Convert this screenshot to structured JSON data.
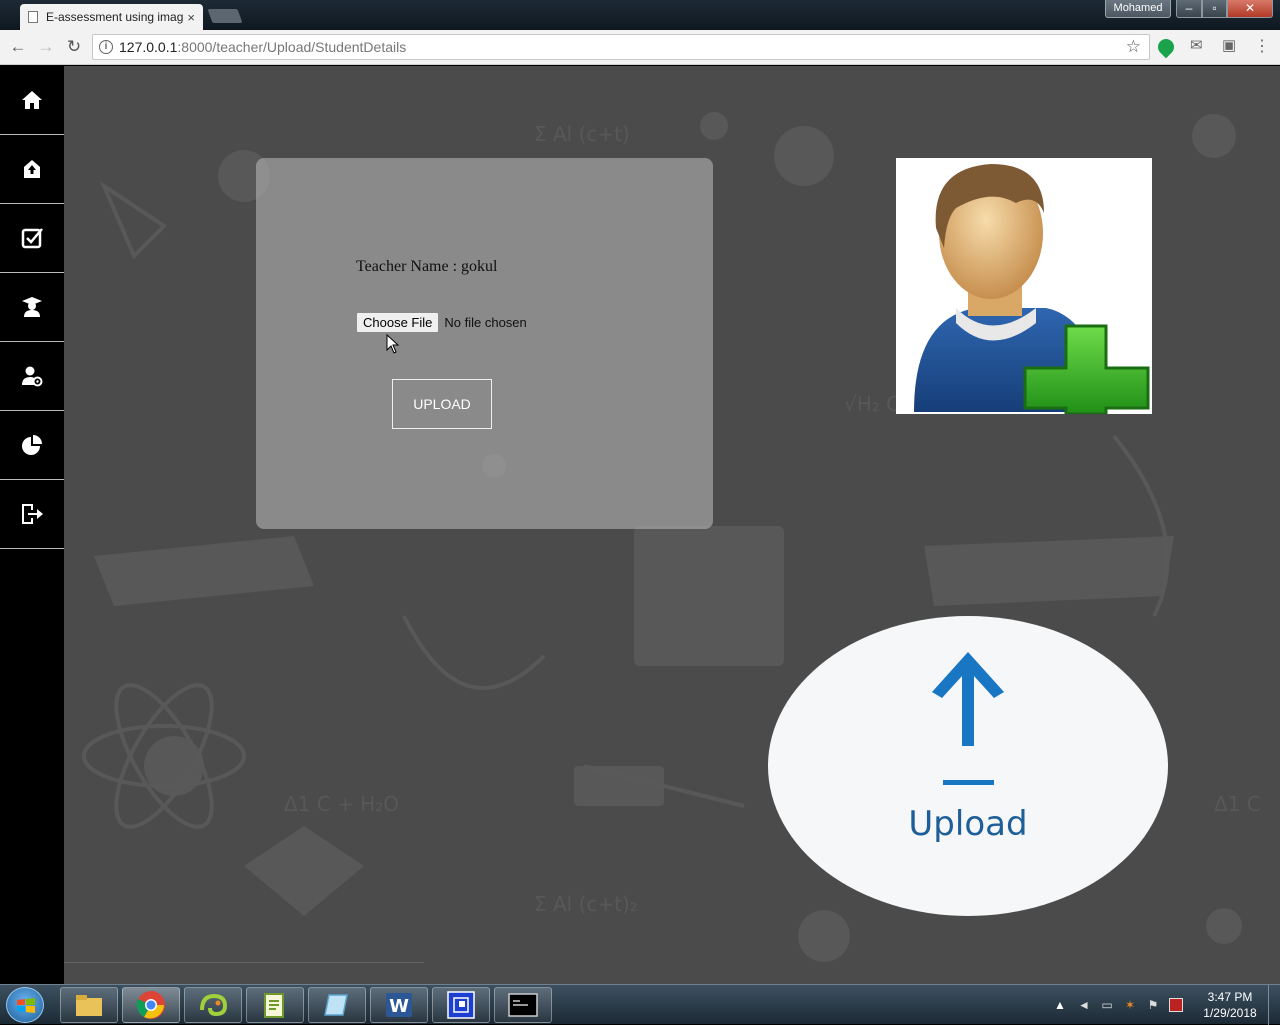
{
  "browser": {
    "tab_title": "E-assessment using imag",
    "tab_close": "×",
    "user_name": "Mohamed",
    "window_controls": {
      "minimize": "‒",
      "maximize": "▫",
      "close": "✕"
    },
    "nav": {
      "back": "←",
      "forward": "→",
      "reload": "↻"
    },
    "url_host": "127.0.0.1",
    "url_rest": ":8000/teacher/Upload/StudentDetails",
    "star": "☆",
    "extensions": {
      "mail": "✉",
      "camera": "▣",
      "menu": "⋮"
    }
  },
  "sidebar": {
    "items": [
      {
        "icon": "home-icon"
      },
      {
        "icon": "upload-house-icon"
      },
      {
        "icon": "checklist-icon"
      },
      {
        "icon": "graduate-icon"
      },
      {
        "icon": "user-settings-icon"
      },
      {
        "icon": "pie-chart-icon"
      },
      {
        "icon": "logout-icon"
      }
    ]
  },
  "form": {
    "teacher_line": "Teacher Name : gokul",
    "choose_file": "Choose File",
    "no_file": "No file chosen",
    "upload_button": "UPLOAD"
  },
  "upload_graphic": {
    "label": "Upload",
    "color": "#1976c2"
  },
  "taskbar": {
    "time": "3:47 PM",
    "date": "1/29/2018",
    "apps": [
      "file-explorer-icon",
      "chrome-icon",
      "chameleon-icon",
      "notepadpp-icon",
      "notepad-icon",
      "word-icon",
      "remote-desktop-icon",
      "cmd-icon"
    ]
  }
}
